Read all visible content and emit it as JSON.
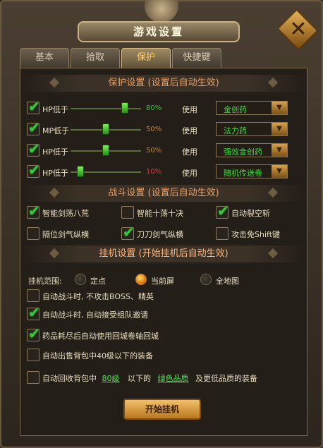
{
  "window": {
    "title": "游戏设置",
    "close_glyph": "✕"
  },
  "tabs": [
    {
      "label": "基本",
      "active": false
    },
    {
      "label": "拾取",
      "active": false
    },
    {
      "label": "保护",
      "active": true
    },
    {
      "label": "快捷键",
      "active": false
    }
  ],
  "protection": {
    "header": "保护设置 (设置后自动生效)",
    "rows": [
      {
        "stat": "HP低于",
        "checked": true,
        "percent": "80%",
        "percent_color": "#3fbf3f",
        "fill": 0.8,
        "use_label": "使用",
        "item": "金创药"
      },
      {
        "stat": "MP低于",
        "checked": true,
        "percent": "50%",
        "percent_color": "#c08a3a",
        "fill": 0.5,
        "use_label": "使用",
        "item": "法力药"
      },
      {
        "stat": "HP低于",
        "checked": true,
        "percent": "50%",
        "percent_color": "#c08a3a",
        "fill": 0.5,
        "use_label": "使用",
        "item": "强效金创药"
      },
      {
        "stat": "HP低于",
        "checked": true,
        "percent": "10%",
        "percent_color": "#d84040",
        "fill": 0.1,
        "use_label": "使用",
        "item": "随机传送卷"
      }
    ]
  },
  "combat": {
    "header": "战斗设置 (设置后自动生效)",
    "options": [
      {
        "label": "智能剑荡八荒",
        "checked": true
      },
      {
        "label": "智能十荡十决",
        "checked": false
      },
      {
        "label": "自动裂空斩",
        "checked": true
      },
      {
        "label": "隔位剑气纵横",
        "checked": false
      },
      {
        "label": "刀刀剑气纵横",
        "checked": true
      },
      {
        "label": "攻击免Shift键",
        "checked": false
      }
    ]
  },
  "idle": {
    "header": "挂机设置 (开始挂机后自动生效)",
    "range_label": "挂机范围:",
    "range_options": [
      {
        "label": "定点",
        "selected": false
      },
      {
        "label": "当前屏",
        "selected": true
      },
      {
        "label": "全地图",
        "selected": false
      }
    ],
    "options": [
      {
        "label": "自动战斗时, 不攻击BOSS、精英",
        "checked": false
      },
      {
        "label": "自动战斗时, 自动接受组队邀请",
        "checked": true
      },
      {
        "label": "药品耗尽后自动使用回城卷轴回城",
        "checked": true
      },
      {
        "label": "自动出售背包中40级以下的装备",
        "checked": false
      }
    ],
    "recycle": {
      "checked": false,
      "prefix": "自动回收背包中",
      "level": "80级",
      "middle": "以下的",
      "quality": "绿色品质",
      "suffix": "及更低品质的装备"
    },
    "start_button": "开始挂机"
  }
}
